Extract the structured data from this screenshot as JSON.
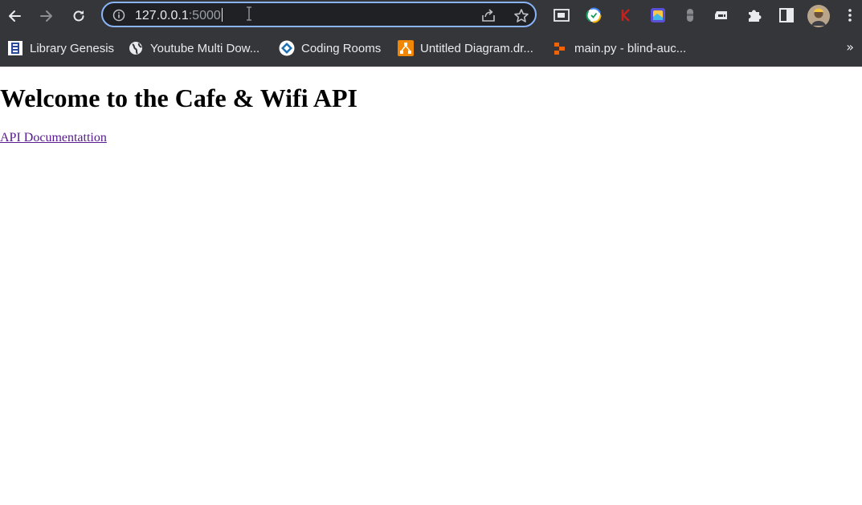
{
  "browser": {
    "address_bar": {
      "host": "127.0.0.1",
      "port": ":5000"
    },
    "toolbar_icons": [
      "back-icon",
      "forward-icon",
      "reload-icon",
      "info-icon",
      "share-icon",
      "star-icon",
      "picture-in-picture-icon",
      "extension-clock-icon",
      "extension-k-icon",
      "extension-colorful-icon",
      "extension-gray-icon",
      "extension-tab-icon",
      "puzzle-icon",
      "side-panel-icon",
      "avatar",
      "menu-icon"
    ],
    "bookmarks": [
      {
        "label": "Library Genesis",
        "icon": "library-genesis-icon"
      },
      {
        "label": "Youtube Multi Dow...",
        "icon": "globe-icon"
      },
      {
        "label": "Coding Rooms",
        "icon": "coding-rooms-icon"
      },
      {
        "label": "Untitled Diagram.dr...",
        "icon": "drawio-icon"
      },
      {
        "label": "main.py - blind-auc...",
        "icon": "replit-icon"
      }
    ],
    "bookmarks_overflow": "»"
  },
  "page": {
    "heading": "Welcome to the Cafe & Wifi API",
    "link": "API Documentattion"
  },
  "colors": {
    "chrome_bg": "#35363a",
    "omnibox_bg": "#202124",
    "omnibox_focus": "#8ab4f8",
    "visited_link": "#551a8b"
  }
}
